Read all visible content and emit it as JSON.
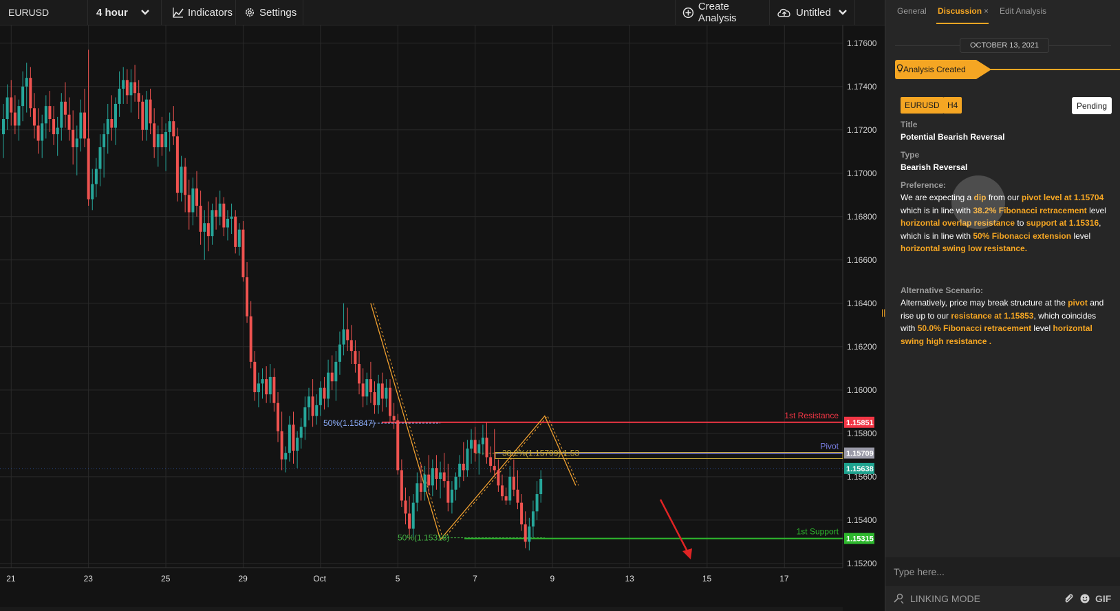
{
  "toolbar": {
    "symbol": "EURUSD",
    "interval": "4 hour",
    "indicators": "Indicators",
    "settings": "Settings",
    "create_analysis": "Create Analysis",
    "layout_name": "Untitled"
  },
  "panel": {
    "tabs": {
      "general": "General",
      "discussion": "Discussion",
      "close": "×",
      "edit": "Edit Analysis"
    },
    "date": "OCTOBER 13, 2021",
    "created": "Analysis Created",
    "tags": {
      "symbol": "EURUSD",
      "timeframe": "H4"
    },
    "status": "Pending",
    "title_label": "Title",
    "title_value": "Potential Bearish Reversal",
    "type_label": "Type",
    "type_value": "Bearish Reversal",
    "preference_label": "Preference:",
    "preference": [
      {
        "t": "We are expecting a ",
        "h": false
      },
      {
        "t": "dip",
        "h": true
      },
      {
        "t": " from our ",
        "h": false
      },
      {
        "t": "pivot level at 1.15704",
        "h": true
      },
      {
        "t": " which is in line with ",
        "h": false
      },
      {
        "t": "38.2% Fibonacci retracement",
        "h": true
      },
      {
        "t": " level ",
        "h": false
      },
      {
        "t": "horizontal overlap resistance",
        "h": true
      },
      {
        "t": " to ",
        "h": false
      },
      {
        "t": "support at 1.15316",
        "h": true
      },
      {
        "t": ", which is in line with ",
        "h": false
      },
      {
        "t": "50% Fibonacci extension",
        "h": true
      },
      {
        "t": " level ",
        "h": false
      },
      {
        "t": "horizontal swing low resistance.",
        "h": true
      }
    ],
    "alternative_label": "Alternative Scenario:",
    "alternative": [
      {
        "t": "Alternatively, price may break structure at the ",
        "h": false
      },
      {
        "t": "pivot",
        "h": true
      },
      {
        "t": " and rise up to our ",
        "h": false
      },
      {
        "t": "resistance at 1.15853",
        "h": true
      },
      {
        "t": ", which coincides with ",
        "h": false
      },
      {
        "t": "50.0% Fibonacci retracement",
        "h": true
      },
      {
        "t": " level ",
        "h": false
      },
      {
        "t": "horizontal swing high resistance .",
        "h": true
      }
    ],
    "input_placeholder": "Type here...",
    "linking_mode": "LINKING MODE",
    "gif": "GIF"
  },
  "chart_data": {
    "type": "candlestick",
    "symbol": "EURUSD",
    "timeframe": "4 hour",
    "y_ticks": [
      "1.17600",
      "1.17400",
      "1.17200",
      "1.17000",
      "1.16800",
      "1.16600",
      "1.16400",
      "1.16200",
      "1.16000",
      "1.15800",
      "1.15600",
      "1.15400",
      "1.15200"
    ],
    "y_tick_values": [
      1.176,
      1.174,
      1.172,
      1.17,
      1.168,
      1.166,
      1.164,
      1.162,
      1.16,
      1.158,
      1.156,
      1.154,
      1.152
    ],
    "ylim": [
      1.1519,
      1.1765
    ],
    "x_ticks": [
      "21",
      "23",
      "25",
      "29",
      "Oct",
      "5",
      "7",
      "9",
      "13",
      "15",
      "17"
    ],
    "x_tick_slots": [
      2,
      22,
      42,
      62,
      82,
      102,
      122,
      142,
      162,
      182,
      202
    ],
    "candles": [
      [
        1.1718,
        1.1732,
        1.1707,
        1.1725
      ],
      [
        1.1725,
        1.1741,
        1.172,
        1.1735
      ],
      [
        1.1735,
        1.1743,
        1.1722,
        1.1728
      ],
      [
        1.1728,
        1.1736,
        1.1718,
        1.1722
      ],
      [
        1.1722,
        1.1734,
        1.1715,
        1.1731
      ],
      [
        1.1731,
        1.1747,
        1.1724,
        1.174
      ],
      [
        1.174,
        1.1751,
        1.1728,
        1.1744
      ],
      [
        1.1744,
        1.1749,
        1.1726,
        1.173
      ],
      [
        1.173,
        1.1737,
        1.1716,
        1.1722
      ],
      [
        1.1722,
        1.173,
        1.1709,
        1.1715
      ],
      [
        1.1715,
        1.1727,
        1.1707,
        1.1723
      ],
      [
        1.1723,
        1.1736,
        1.1716,
        1.1731
      ],
      [
        1.1731,
        1.1738,
        1.1719,
        1.1725
      ],
      [
        1.1725,
        1.1731,
        1.1713,
        1.1718
      ],
      [
        1.1718,
        1.1726,
        1.1708,
        1.1721
      ],
      [
        1.1721,
        1.1737,
        1.1715,
        1.1733
      ],
      [
        1.1733,
        1.1742,
        1.1721,
        1.1727
      ],
      [
        1.1727,
        1.1735,
        1.1715,
        1.172
      ],
      [
        1.172,
        1.1729,
        1.1704,
        1.1712
      ],
      [
        1.1712,
        1.1722,
        1.1699,
        1.1716
      ],
      [
        1.1716,
        1.1734,
        1.171,
        1.1728
      ],
      [
        1.1728,
        1.1739,
        1.1712,
        1.1716
      ],
      [
        1.1716,
        1.1757,
        1.1685,
        1.1688
      ],
      [
        1.1688,
        1.1702,
        1.1683,
        1.1695
      ],
      [
        1.1695,
        1.1707,
        1.1689,
        1.1702
      ],
      [
        1.1702,
        1.1718,
        1.1694,
        1.1712
      ],
      [
        1.1712,
        1.1723,
        1.1698,
        1.1718
      ],
      [
        1.1718,
        1.1732,
        1.1709,
        1.1725
      ],
      [
        1.1725,
        1.1736,
        1.1715,
        1.1721
      ],
      [
        1.1721,
        1.1735,
        1.1713,
        1.1732
      ],
      [
        1.1732,
        1.1747,
        1.1726,
        1.1739
      ],
      [
        1.1739,
        1.1749,
        1.1732,
        1.1743
      ],
      [
        1.1743,
        1.1748,
        1.1732,
        1.1736
      ],
      [
        1.1736,
        1.1748,
        1.1728,
        1.1742
      ],
      [
        1.1742,
        1.175,
        1.1733,
        1.1737
      ],
      [
        1.1737,
        1.1743,
        1.1725,
        1.1733
      ],
      [
        1.1733,
        1.1736,
        1.1715,
        1.172
      ],
      [
        1.172,
        1.1738,
        1.1715,
        1.1734
      ],
      [
        1.1734,
        1.1739,
        1.1718,
        1.1723
      ],
      [
        1.1723,
        1.173,
        1.1707,
        1.1712
      ],
      [
        1.1712,
        1.1722,
        1.1703,
        1.1718
      ],
      [
        1.1718,
        1.1726,
        1.1708,
        1.1712
      ],
      [
        1.1712,
        1.1723,
        1.1701,
        1.1719
      ],
      [
        1.1719,
        1.1728,
        1.171,
        1.1724
      ],
      [
        1.1724,
        1.1731,
        1.1713,
        1.1717
      ],
      [
        1.1717,
        1.1721,
        1.1687,
        1.1691
      ],
      [
        1.1691,
        1.1708,
        1.1687,
        1.1703
      ],
      [
        1.1703,
        1.1707,
        1.1682,
        1.169
      ],
      [
        1.169,
        1.1697,
        1.1674,
        1.1682
      ],
      [
        1.1682,
        1.1698,
        1.1676,
        1.1693
      ],
      [
        1.1693,
        1.1701,
        1.168,
        1.1685
      ],
      [
        1.1685,
        1.1692,
        1.1667,
        1.1673
      ],
      [
        1.1673,
        1.1683,
        1.166,
        1.1677
      ],
      [
        1.1677,
        1.1687,
        1.1664,
        1.1671
      ],
      [
        1.1671,
        1.1686,
        1.1667,
        1.1683
      ],
      [
        1.1683,
        1.1689,
        1.1674,
        1.168
      ],
      [
        1.168,
        1.1692,
        1.1676,
        1.1686
      ],
      [
        1.1686,
        1.1689,
        1.1671,
        1.1675
      ],
      [
        1.1675,
        1.1683,
        1.1669,
        1.1679
      ],
      [
        1.1679,
        1.1686,
        1.1672,
        1.168
      ],
      [
        1.168,
        1.1683,
        1.1663,
        1.1666
      ],
      [
        1.1666,
        1.1677,
        1.1662,
        1.1674
      ],
      [
        1.1674,
        1.1678,
        1.165,
        1.1652
      ],
      [
        1.1652,
        1.1659,
        1.1631,
        1.1634
      ],
      [
        1.1634,
        1.1641,
        1.161,
        1.1613
      ],
      [
        1.1613,
        1.1618,
        1.1595,
        1.1599
      ],
      [
        1.1599,
        1.1608,
        1.1592,
        1.1603
      ],
      [
        1.1603,
        1.161,
        1.1596,
        1.1605
      ],
      [
        1.1605,
        1.1611,
        1.1594,
        1.1598
      ],
      [
        1.1598,
        1.1612,
        1.1594,
        1.1606
      ],
      [
        1.1606,
        1.161,
        1.159,
        1.1594
      ],
      [
        1.1594,
        1.1599,
        1.1576,
        1.1581
      ],
      [
        1.1581,
        1.159,
        1.1563,
        1.1568
      ],
      [
        1.1568,
        1.1574,
        1.1562,
        1.1571
      ],
      [
        1.1571,
        1.1588,
        1.1567,
        1.1584
      ],
      [
        1.1584,
        1.159,
        1.1566,
        1.1572
      ],
      [
        1.1572,
        1.1581,
        1.1564,
        1.1578
      ],
      [
        1.1578,
        1.1587,
        1.1573,
        1.1583
      ],
      [
        1.1583,
        1.1597,
        1.1577,
        1.1592
      ],
      [
        1.1592,
        1.1601,
        1.1586,
        1.1597
      ],
      [
        1.1597,
        1.1605,
        1.1583,
        1.1588
      ],
      [
        1.1588,
        1.1598,
        1.1584,
        1.1593
      ],
      [
        1.1593,
        1.1604,
        1.1588,
        1.1601
      ],
      [
        1.1601,
        1.1606,
        1.1591,
        1.1596
      ],
      [
        1.1596,
        1.1614,
        1.1592,
        1.1608
      ],
      [
        1.1608,
        1.1616,
        1.16,
        1.1604
      ],
      [
        1.1604,
        1.1618,
        1.1595,
        1.1613
      ],
      [
        1.1613,
        1.1627,
        1.1607,
        1.1621
      ],
      [
        1.1621,
        1.164,
        1.1616,
        1.1628
      ],
      [
        1.1628,
        1.1638,
        1.1618,
        1.1623
      ],
      [
        1.1623,
        1.163,
        1.1612,
        1.1618
      ],
      [
        1.1618,
        1.1623,
        1.1608,
        1.1612
      ],
      [
        1.1612,
        1.1618,
        1.1598,
        1.1603
      ],
      [
        1.1603,
        1.161,
        1.1592,
        1.1597
      ],
      [
        1.1597,
        1.1608,
        1.1593,
        1.1605
      ],
      [
        1.1605,
        1.1613,
        1.1594,
        1.1599
      ],
      [
        1.1599,
        1.1604,
        1.1589,
        1.1593
      ],
      [
        1.1593,
        1.1607,
        1.1589,
        1.1603
      ],
      [
        1.1603,
        1.1608,
        1.159,
        1.1596
      ],
      [
        1.1596,
        1.1605,
        1.1592,
        1.1601
      ],
      [
        1.1601,
        1.1605,
        1.1585,
        1.1588
      ],
      [
        1.1588,
        1.1594,
        1.1582,
        1.1586
      ],
      [
        1.1586,
        1.1589,
        1.1561,
        1.1563
      ],
      [
        1.1563,
        1.1568,
        1.1546,
        1.1549
      ],
      [
        1.1549,
        1.1555,
        1.1538,
        1.1543
      ],
      [
        1.1543,
        1.1551,
        1.1531,
        1.1536
      ],
      [
        1.1536,
        1.1552,
        1.1532,
        1.1548
      ],
      [
        1.1548,
        1.1562,
        1.1544,
        1.1557
      ],
      [
        1.1557,
        1.1566,
        1.1549,
        1.1553
      ],
      [
        1.1553,
        1.1565,
        1.1549,
        1.1561
      ],
      [
        1.1561,
        1.157,
        1.1552,
        1.1556
      ],
      [
        1.1556,
        1.1568,
        1.1551,
        1.1564
      ],
      [
        1.1564,
        1.157,
        1.1554,
        1.1559
      ],
      [
        1.1559,
        1.1567,
        1.155,
        1.1562
      ],
      [
        1.1562,
        1.1571,
        1.1555,
        1.1558
      ],
      [
        1.1558,
        1.1566,
        1.1544,
        1.1548
      ],
      [
        1.1548,
        1.1558,
        1.1543,
        1.1554
      ],
      [
        1.1554,
        1.1562,
        1.1549,
        1.156
      ],
      [
        1.156,
        1.157,
        1.1555,
        1.1566
      ],
      [
        1.1566,
        1.1576,
        1.1558,
        1.1563
      ],
      [
        1.1563,
        1.1577,
        1.156,
        1.1573
      ],
      [
        1.1573,
        1.1582,
        1.1566,
        1.1577
      ],
      [
        1.1577,
        1.1583,
        1.1567,
        1.1571
      ],
      [
        1.1571,
        1.1577,
        1.1561,
        1.1575
      ],
      [
        1.1575,
        1.1584,
        1.157,
        1.1578
      ],
      [
        1.1578,
        1.1585,
        1.1566,
        1.1569
      ],
      [
        1.1569,
        1.1574,
        1.1562,
        1.1565
      ],
      [
        1.1565,
        1.1582,
        1.156,
        1.1563
      ],
      [
        1.1563,
        1.1568,
        1.1553,
        1.1556
      ],
      [
        1.1556,
        1.1561,
        1.1549,
        1.1551
      ],
      [
        1.1551,
        1.1555,
        1.1547,
        1.1549
      ],
      [
        1.1549,
        1.1565,
        1.1547,
        1.156
      ],
      [
        1.156,
        1.1568,
        1.1551,
        1.1554
      ],
      [
        1.1554,
        1.1563,
        1.1545,
        1.1548
      ],
      [
        1.1548,
        1.1552,
        1.1535,
        1.1538
      ],
      [
        1.1538,
        1.1544,
        1.1527,
        1.153
      ],
      [
        1.153,
        1.1541,
        1.1526,
        1.1537
      ],
      [
        1.1537,
        1.1549,
        1.1532,
        1.1544
      ],
      [
        1.1544,
        1.1558,
        1.154,
        1.1552
      ],
      [
        1.1552,
        1.1563,
        1.1548,
        1.1559
      ]
    ],
    "levels": [
      {
        "name": "1st Resistance",
        "price": 1.15851,
        "color": "#f23645"
      },
      {
        "name": "Pivot",
        "price": 1.15709,
        "color": "#7b7fe6"
      },
      {
        "name": "1st Support",
        "price": 1.15315,
        "color": "#2eb82e"
      }
    ],
    "current_price": 1.15638,
    "fib_labels": [
      {
        "text": "50%(1.15847)",
        "price": 1.15847,
        "color": "#8fb0ff"
      },
      {
        "text": "38.2%(1.15709) 1.53",
        "price": 1.15709,
        "color": "#c8a93a"
      },
      {
        "text": "50%(1.15318)",
        "price": 1.15318,
        "color": "#45b545"
      }
    ],
    "colors": {
      "up": "#26a69a",
      "down": "#ef5350",
      "grid": "#2a2a2a",
      "bg": "#131313",
      "projection": "#e02424",
      "fib": "#f0a030"
    }
  }
}
